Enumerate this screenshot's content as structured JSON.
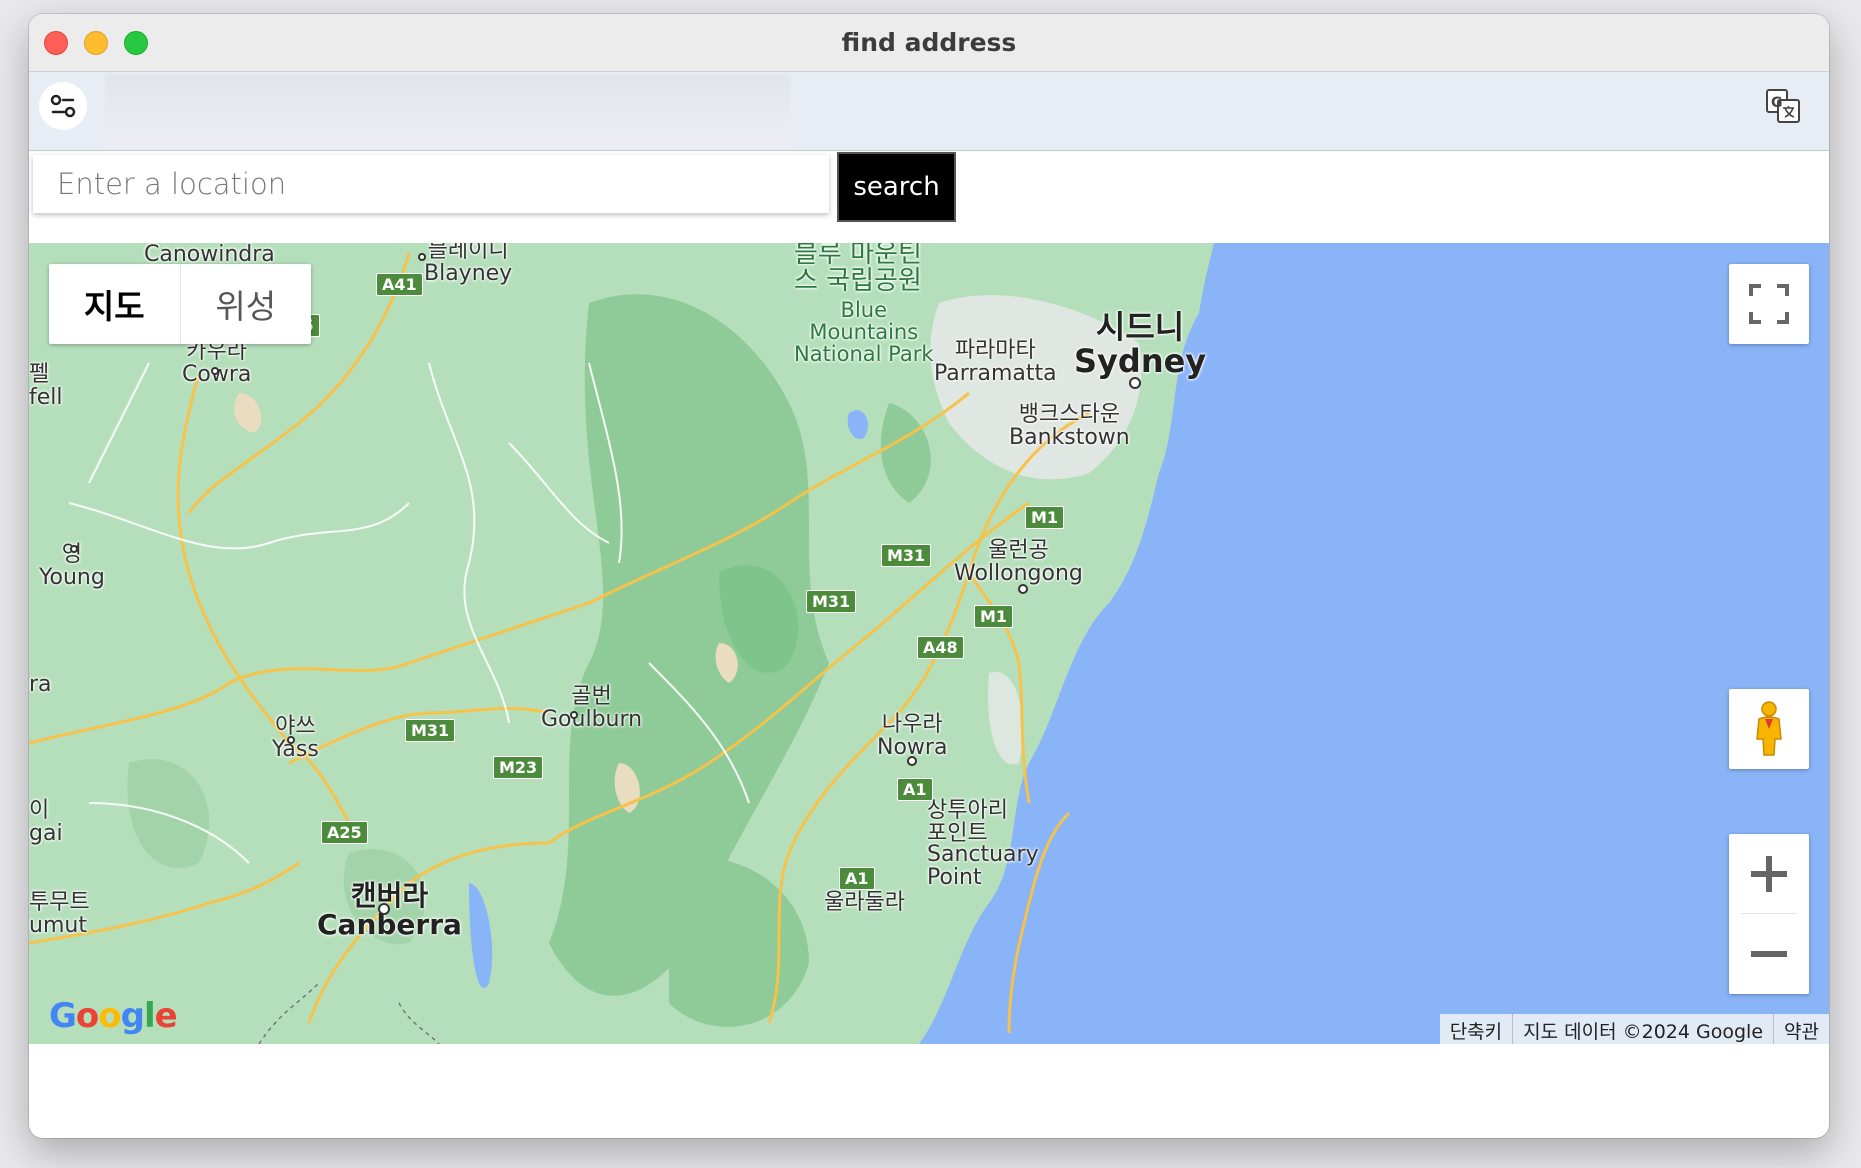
{
  "window": {
    "title": "find address"
  },
  "toolbar": {
    "tune_icon": "tune-icon",
    "translate_icon": "translate-icon"
  },
  "search": {
    "placeholder": "Enter a location",
    "value": "",
    "button_label": "search"
  },
  "map": {
    "map_types": [
      {
        "label": "지도",
        "active": true
      },
      {
        "label": "위성",
        "active": false
      }
    ],
    "controls": {
      "fullscreen_icon": "fullscreen-icon",
      "pegman_icon": "pegman-icon",
      "zoom_in": "+",
      "zoom_out": "−"
    },
    "logo": "Google",
    "attribution": {
      "shortcuts": "단축키",
      "data": "지도 데이터 ©2024 Google",
      "terms": "약관"
    },
    "places": [
      {
        "id": "canowindra",
        "name": "Canowindra"
      },
      {
        "id": "blayney",
        "ko": "블레이니",
        "name": "Blayney"
      },
      {
        "id": "cowra",
        "ko": "카우라",
        "name": "Cowra"
      },
      {
        "id": "forbes",
        "ko": "펠",
        "name": "fell"
      },
      {
        "id": "young",
        "ko": "영",
        "name": "Young"
      },
      {
        "id": "ra",
        "name": "ra"
      },
      {
        "id": "yass",
        "ko": "야쓰",
        "name": "Yass"
      },
      {
        "id": "gai",
        "ko": "이",
        "name": "gai"
      },
      {
        "id": "tumut",
        "ko": "투무트",
        "name": "umut"
      },
      {
        "id": "canberra",
        "ko": "캔버라",
        "name": "Canberra"
      },
      {
        "id": "goulburn",
        "ko": "골번",
        "name": "Goulburn"
      },
      {
        "id": "bluemountains",
        "ko": "블루 마운틴\n스 국립공원",
        "name": "Blue\nMountains\nNational Park"
      },
      {
        "id": "parramatta",
        "ko": "파라마타",
        "name": "Parramatta"
      },
      {
        "id": "sydney",
        "ko": "시드니",
        "name": "Sydney"
      },
      {
        "id": "bankstown",
        "ko": "뱅크스타운",
        "name": "Bankstown"
      },
      {
        "id": "wollongong",
        "ko": "울런공",
        "name": "Wollongong"
      },
      {
        "id": "nowra",
        "ko": "나우라",
        "name": "Nowra"
      },
      {
        "id": "sanctuary",
        "ko": "상투아리\n포인트",
        "name": "Sanctuary\nPoint"
      },
      {
        "id": "ulladulla",
        "ko": "울라둘라",
        "name": ""
      }
    ],
    "road_shields": [
      "A41",
      "A15",
      "M1",
      "M31",
      "M31",
      "M1",
      "A48",
      "M31",
      "M23",
      "A1",
      "A25",
      "A1"
    ]
  }
}
